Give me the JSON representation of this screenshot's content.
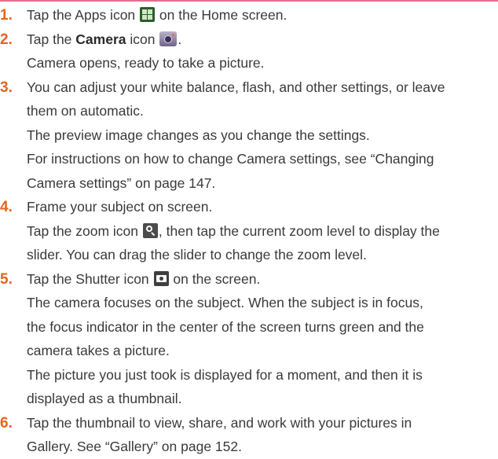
{
  "steps": [
    {
      "number": "1.",
      "lines": {
        "l1_a": "Tap the Apps icon ",
        "l1_b": " on the Home screen."
      }
    },
    {
      "number": "2.",
      "l1_a": "Tap the ",
      "l1_bold": "Camera",
      "l1_b": " icon ",
      "l1_c": ".",
      "l2": "Camera opens, ready to take a picture."
    },
    {
      "number": "3.",
      "l1": "You can adjust your white balance, flash, and other settings, or leave",
      "l2": "them on automatic.",
      "l3": "The preview image changes as you change the settings.",
      "l4": "For instructions on how to change Camera settings, see “Changing",
      "l5": "Camera settings” on page 147."
    },
    {
      "number": "4.",
      "l1": "Frame your subject on screen.",
      "l2_a": "Tap the zoom icon ",
      "l2_b": ", then tap the current zoom level to display the",
      "l3": "slider. You can drag the slider to change the zoom level."
    },
    {
      "number": "5.",
      "l1_a": "Tap the Shutter icon ",
      "l1_b": " on the screen.",
      "l2": "The camera focuses on the subject. When the subject is in focus,",
      "l3": "the focus indicator in the center of the screen turns green and the",
      "l4": "camera takes a picture.",
      "l5": "The picture you just took is displayed for a moment, and then it is",
      "l6": "displayed as a thumbnail."
    },
    {
      "number": "6.",
      "l1": "Tap the thumbnail to view, share, and work with your pictures in",
      "l2": "Gallery. See “Gallery” on page 152."
    }
  ],
  "icons": {
    "apps": "apps-icon",
    "camera": "camera-icon",
    "zoom": "zoom-icon",
    "shutter": "shutter-icon"
  },
  "colors": {
    "step_number": "#e8641c",
    "top_rule": "#e06e8e",
    "body_text": "#3a3a3a"
  }
}
